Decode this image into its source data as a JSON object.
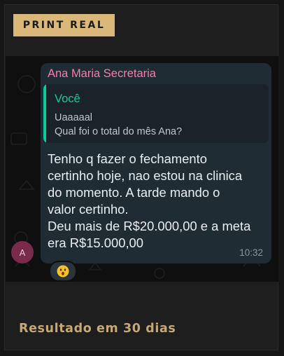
{
  "badge": {
    "label": "PRINT REAL"
  },
  "chat": {
    "avatar_initial": "A",
    "message": {
      "sender": "Ana Maria Secretaria",
      "quoted": {
        "author": "Você",
        "lines": [
          "Uaaaaal",
          "Qual foi o total do mês Ana?"
        ]
      },
      "text_lines": [
        "Tenho q fazer o fechamento",
        "certinho hoje, nao estou na clinica",
        "do momento. A tarde mando o",
        "valor certinho.",
        "Deu mais de R$20.000,00 e a meta",
        "era R$15.000,00"
      ],
      "time": "10:32",
      "reaction_icon": "astonished-face-emoji"
    }
  },
  "footer": {
    "caption": "Resultado em 30 dias"
  },
  "colors": {
    "badge_bg": "#d9b87a",
    "sender_name": "#f57da8",
    "quote_author": "#06cf9c",
    "bubble_bg": "#202c33",
    "footer_text": "#c7a875"
  }
}
